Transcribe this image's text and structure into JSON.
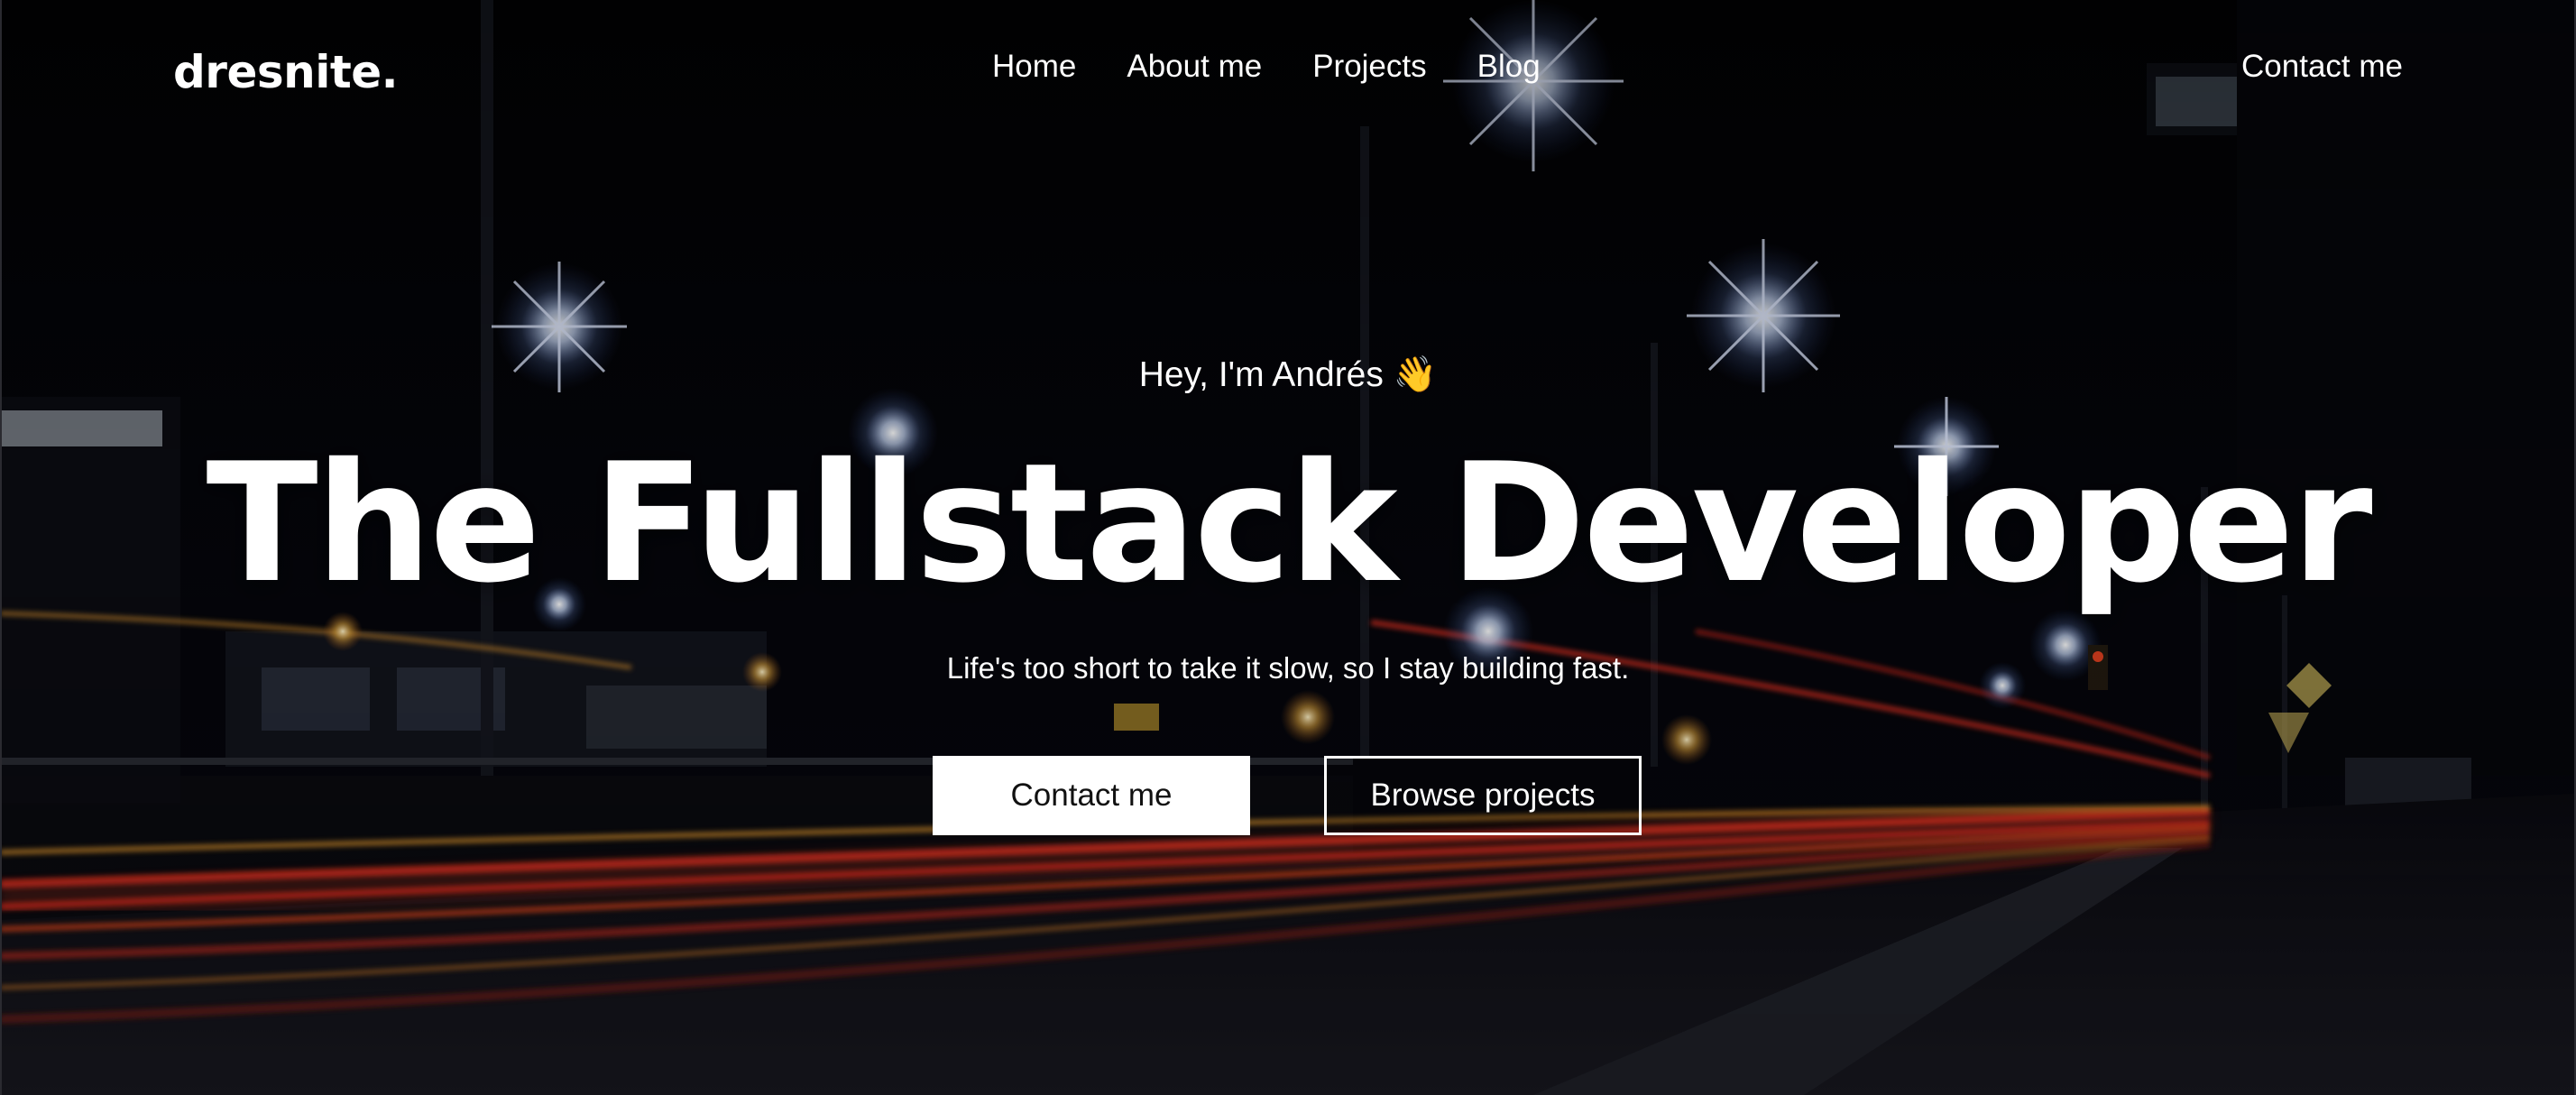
{
  "brand": {
    "logo_text": "dresnite."
  },
  "nav": {
    "links": [
      {
        "label": "Home"
      },
      {
        "label": "About me"
      },
      {
        "label": "Projects"
      },
      {
        "label": "Blog"
      }
    ],
    "contact_label": "Contact me"
  },
  "hero": {
    "greeting": "Hey, I'm Andrés 👋",
    "title": "The Fullstack Developer",
    "subtitle": "Life's too short to take it slow, so I stay building fast.",
    "primary_button": "Contact me",
    "secondary_button": "Browse projects"
  },
  "colors": {
    "text": "#ffffff",
    "primary_button_bg": "#ffffff",
    "primary_button_text": "#111111",
    "background": "#030305",
    "light_trail_red": "#e0301e",
    "light_trail_orange": "#f0a030",
    "street_light_blue": "#9fc4ff"
  }
}
